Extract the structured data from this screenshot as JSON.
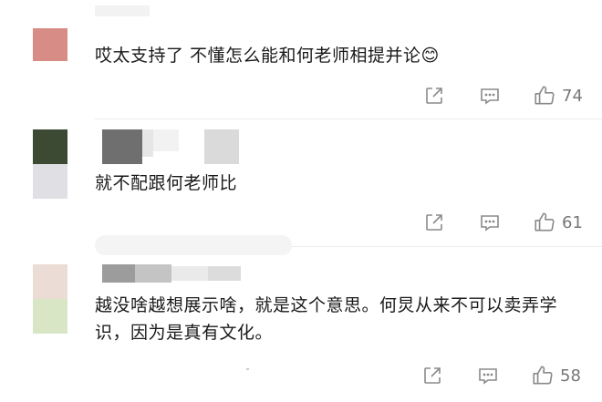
{
  "comments": [
    {
      "text": "哎太支持了 不懂怎么能和何老师相提并论",
      "emoji": "😊",
      "likes": "74",
      "avatar_colors": [
        "#d88c86"
      ]
    },
    {
      "text": "就不配跟何老师比",
      "likes": "61",
      "avatar_colors": [
        "#3d4a33",
        "#e0e0e4"
      ]
    },
    {
      "text": "越没啥越想展示啥，就是这个意思。何炅从来不可以卖弄学识，因为是真有文化。",
      "likes": "58",
      "avatar_colors": [
        "#ecdcd6",
        "#d9e6c6"
      ]
    }
  ],
  "icons": {
    "share": "share-icon",
    "reply": "comment-icon",
    "like": "thumbs-up-icon"
  }
}
